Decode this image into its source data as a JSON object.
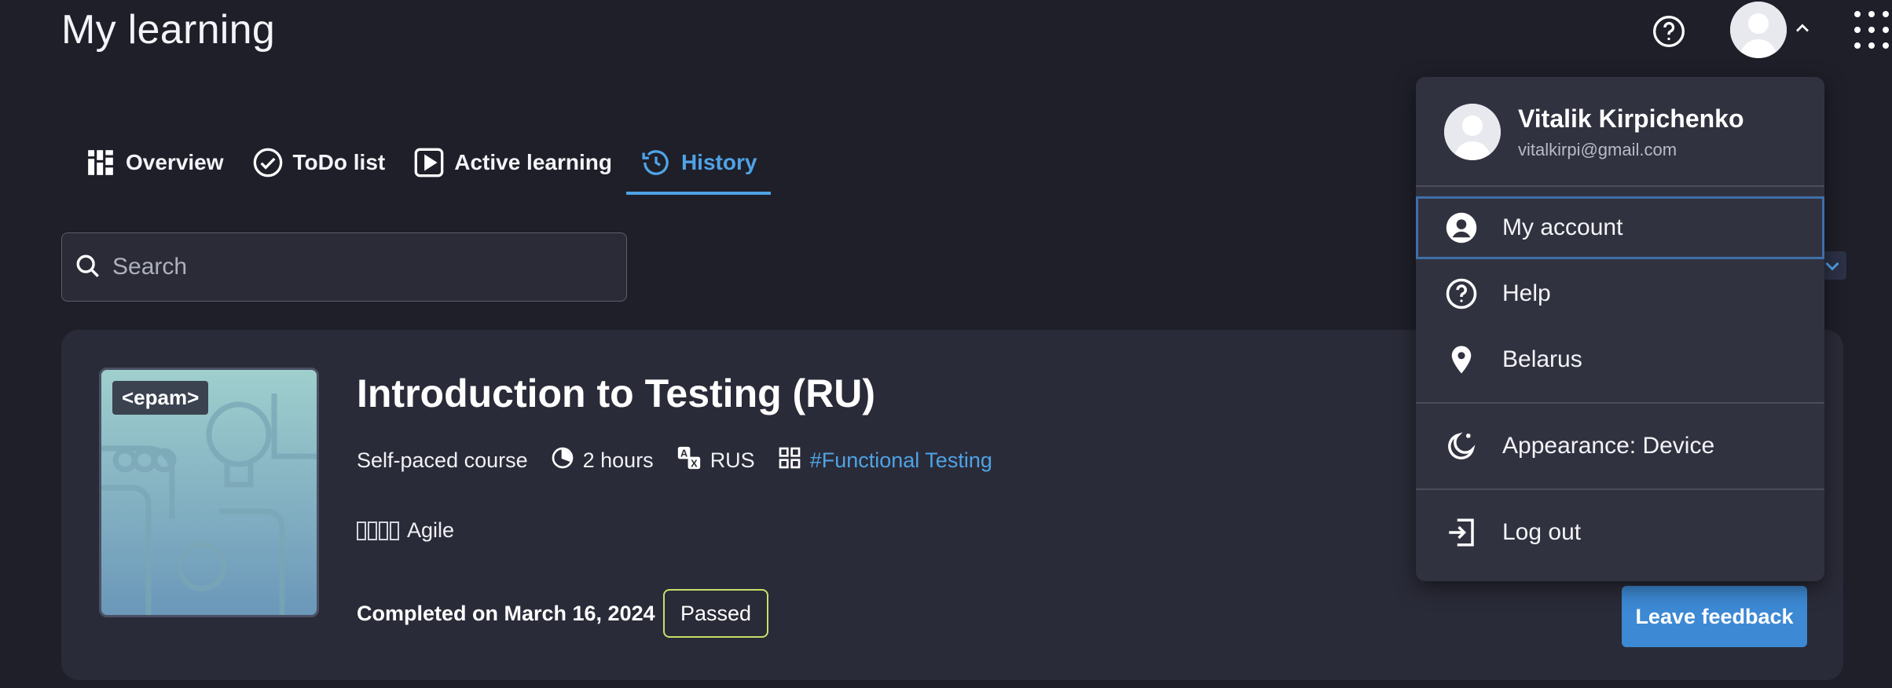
{
  "header": {
    "title": "My learning",
    "help_icon": "help-circle-icon",
    "avatar_icon": "user-avatar",
    "chevron_icon": "chevron-up-icon",
    "apps_icon": "apps-grid-icon"
  },
  "tabs": [
    {
      "label": "Overview",
      "icon": "grid-icon",
      "active": false
    },
    {
      "label": "ToDo list",
      "icon": "check-circle-icon",
      "active": false
    },
    {
      "label": "Active learning",
      "icon": "play-square-icon",
      "active": false
    },
    {
      "label": "History",
      "icon": "history-icon",
      "active": true
    }
  ],
  "search": {
    "placeholder": "Search",
    "value": ""
  },
  "course": {
    "logo_text": "<epam>",
    "title": "Introduction to Testing (RU)",
    "type": "Self-paced course",
    "duration": "2 hours",
    "language": "RUS",
    "tag": "#Functional Testing",
    "skill": "Agile",
    "completed": "Completed on March 16, 2024",
    "status": "Passed",
    "feedback_label": "Leave feedback"
  },
  "user_menu": {
    "name": "Vitalik Kirpichenko",
    "email": "vitalkirpi@gmail.com",
    "items": [
      {
        "label": "My account",
        "icon": "account-circle-icon"
      },
      {
        "label": "Help",
        "icon": "help-circle-icon"
      },
      {
        "label": "Belarus",
        "icon": "location-pin-icon"
      },
      {
        "label": "Appearance: Device",
        "icon": "moon-icon"
      },
      {
        "label": "Log out",
        "icon": "logout-icon"
      }
    ]
  },
  "colors": {
    "background": "#1e1f29",
    "card": "#2a2b38",
    "menu": "#31323f",
    "accent": "#4fa3e6",
    "button": "#3d89d4",
    "passed_border": "#c7e06a"
  }
}
